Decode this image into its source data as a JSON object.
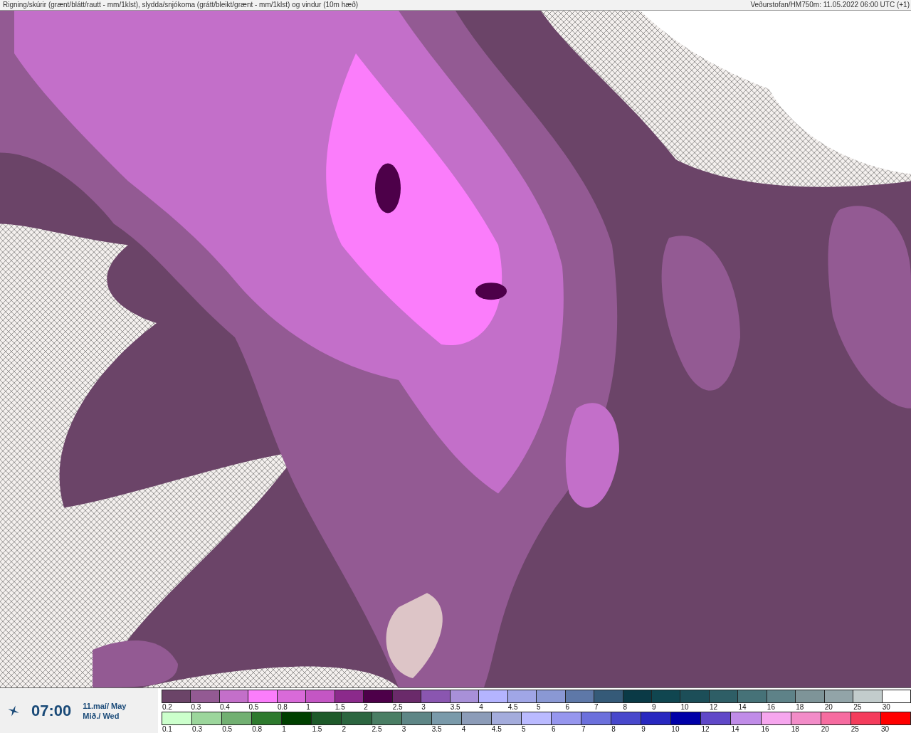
{
  "header": {
    "title": "Rigning/skúrir (grænt/blátt/rautt - mm/1klst), slydda/snjókoma (grátt/bleikt/grænt - mm/1klst) og vindur (10m hæð)",
    "source": "Veðurstofan/HM750m: 11.05.2022 06:00 UTC (+1)"
  },
  "time_panel": {
    "time": "07:00",
    "date": "11.maí/ May",
    "weekday": "Mið./ Wed"
  },
  "legend": {
    "snow_scale": [
      {
        "label": "0.2",
        "color": "#6b4468"
      },
      {
        "label": "0.3",
        "color": "#935a93"
      },
      {
        "label": "0.4",
        "color": "#c36fc9"
      },
      {
        "label": "0.5",
        "color": "#fb7dfb"
      },
      {
        "label": "0.8",
        "color": "#d96ad9"
      },
      {
        "label": "1",
        "color": "#c456c4"
      },
      {
        "label": "1.5",
        "color": "#8b2a8b"
      },
      {
        "label": "2",
        "color": "#4d0049"
      },
      {
        "label": "2.5",
        "color": "#6a2a6a"
      },
      {
        "label": "3",
        "color": "#8a56b0"
      },
      {
        "label": "3.5",
        "color": "#a890d8"
      },
      {
        "label": "4",
        "color": "#b4b4ff"
      },
      {
        "label": "4.5",
        "color": "#a0a6e6"
      },
      {
        "label": "5",
        "color": "#8a98d4"
      },
      {
        "label": "6",
        "color": "#5e78a8"
      },
      {
        "label": "7",
        "color": "#355a78"
      },
      {
        "label": "8",
        "color": "#0a3a46"
      },
      {
        "label": "9",
        "color": "#104650"
      },
      {
        "label": "10",
        "color": "#1c4e58"
      },
      {
        "label": "12",
        "color": "#2e5e66"
      },
      {
        "label": "14",
        "color": "#467278"
      },
      {
        "label": "16",
        "color": "#5e8288"
      },
      {
        "label": "18",
        "color": "#7e9498"
      },
      {
        "label": "20",
        "color": "#92a4a8"
      },
      {
        "label": "25",
        "color": "#c2cccc"
      },
      {
        "label": "30",
        "color": "#ffffff"
      }
    ],
    "rain_scale": [
      {
        "label": "0.1",
        "color": "#ccffcc"
      },
      {
        "label": "0.3",
        "color": "#9cd69c"
      },
      {
        "label": "0.5",
        "color": "#72b072"
      },
      {
        "label": "0.8",
        "color": "#2e7a2e"
      },
      {
        "label": "1",
        "color": "#004000"
      },
      {
        "label": "1.5",
        "color": "#1e5a2a"
      },
      {
        "label": "2",
        "color": "#2c6640"
      },
      {
        "label": "2.5",
        "color": "#4a7e64"
      },
      {
        "label": "3",
        "color": "#5e8686"
      },
      {
        "label": "3.5",
        "color": "#7a9aaa"
      },
      {
        "label": "4",
        "color": "#8c9cb8"
      },
      {
        "label": "4.5",
        "color": "#a4acdc"
      },
      {
        "label": "5",
        "color": "#babaff"
      },
      {
        "label": "6",
        "color": "#9696ee"
      },
      {
        "label": "7",
        "color": "#6c70dc"
      },
      {
        "label": "8",
        "color": "#4848cc"
      },
      {
        "label": "9",
        "color": "#2828c0"
      },
      {
        "label": "10",
        "color": "#0000a8"
      },
      {
        "label": "12",
        "color": "#6048c8"
      },
      {
        "label": "14",
        "color": "#c08ce8"
      },
      {
        "label": "16",
        "color": "#f6a6ee"
      },
      {
        "label": "18",
        "color": "#f28cc8"
      },
      {
        "label": "20",
        "color": "#f66ca0"
      },
      {
        "label": "25",
        "color": "#f43c5c"
      },
      {
        "label": "30",
        "color": "#ff0000"
      }
    ]
  }
}
